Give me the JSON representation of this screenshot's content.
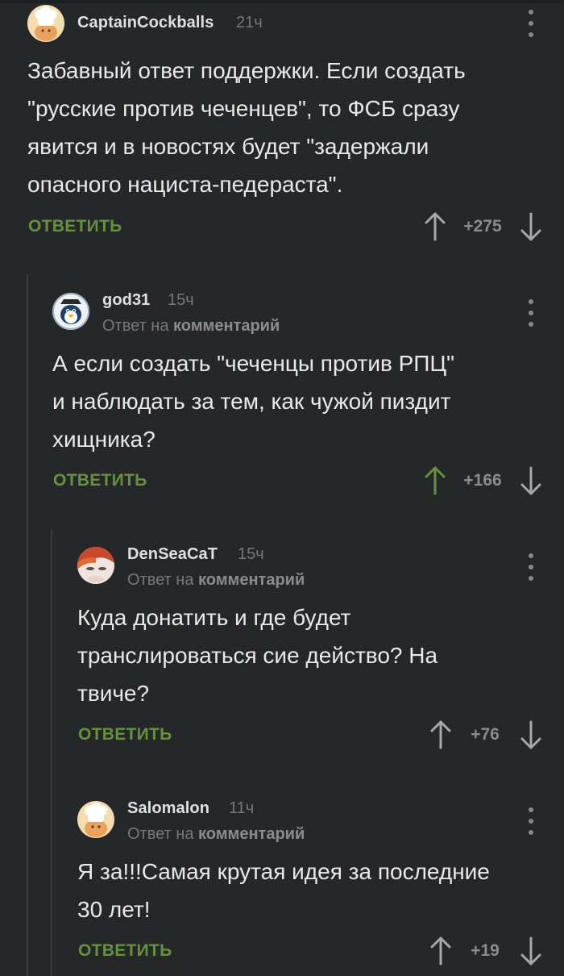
{
  "colors": {
    "background": "#262729",
    "reply_button": "#64923e",
    "upvote_active": "#64923e",
    "muted": "#76787c"
  },
  "comments": [
    {
      "author": "CaptainCockballs",
      "time": "21ч",
      "avatar_icon": "cook-hat-avatar-icon",
      "lines": [
        "Забавный ответ поддержки. Если создать",
        "\"русские против чеченцев\", то ФСБ сразу",
        "явится и в новостях будет \"задержали",
        "опасного нациста-педераста\"."
      ],
      "reply_label": "ОТВЕТИТЬ",
      "rating": "+275",
      "upvoted": false
    },
    {
      "author": "god31",
      "time": "15ч",
      "avatar_icon": "penguin-avatar-icon",
      "reply_prefix": "Ответ на",
      "reply_target": "комментарий",
      "lines": [
        "А если создать \"чеченцы против РПЦ\"",
        "и наблюдать за тем, как чужой пиздит",
        "хищника?"
      ],
      "reply_label": "ОТВЕТИТЬ",
      "rating": "+166",
      "upvoted": true
    },
    {
      "author": "DenSeaCaT",
      "time": "15ч",
      "avatar_icon": "redhead-avatar-icon",
      "reply_prefix": "Ответ на",
      "reply_target": "комментарий",
      "lines": [
        "Куда донатить и где будет",
        "транслироваться сие действо? На",
        "твиче?"
      ],
      "reply_label": "ОТВЕТИТЬ",
      "rating": "+76",
      "upvoted": false
    },
    {
      "author": "Salomalon",
      "time": "11ч",
      "avatar_icon": "cook-hat-avatar-icon",
      "reply_prefix": "Ответ на",
      "reply_target": "комментарий",
      "lines": [
        "Я за!!!Самая крутая идея за последние",
        "30 лет!"
      ],
      "reply_label": "ОТВЕТИТЬ",
      "rating": "+19",
      "upvoted": false
    }
  ]
}
